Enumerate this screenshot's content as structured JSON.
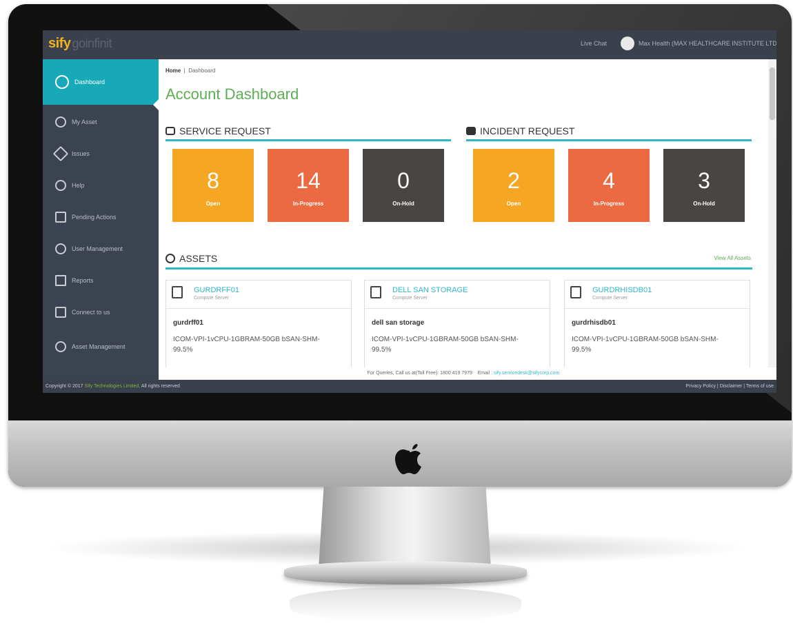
{
  "app": {
    "logo_brand": "sify",
    "logo_product": "goinfinit"
  },
  "topbar": {
    "live_chat": "Live Chat",
    "user_name": "Max Health (MAX HEALTHCARE INSTITUTE LTD)"
  },
  "sidebar": {
    "items": [
      {
        "label": "Dashboard",
        "icon": "dashboard-icon"
      },
      {
        "label": "My Asset",
        "icon": "asset-icon"
      },
      {
        "label": "Issues",
        "icon": "issues-icon"
      },
      {
        "label": "Help",
        "icon": "help-icon"
      },
      {
        "label": "Pending Actions",
        "icon": "pending-icon"
      },
      {
        "label": "User Management",
        "icon": "user-management-icon"
      },
      {
        "label": "Reports",
        "icon": "reports-icon"
      },
      {
        "label": "Connect to us",
        "icon": "chat-icon"
      },
      {
        "label": "Asset Management",
        "icon": "asset-management-icon"
      }
    ]
  },
  "breadcrumb": {
    "home": "Home",
    "current": "Dashboard"
  },
  "page_title": "Account Dashboard",
  "service_request": {
    "title": "SERVICE REQUEST",
    "tiles": [
      {
        "value": "8",
        "label": "Open"
      },
      {
        "value": "14",
        "label": "In-Progress"
      },
      {
        "value": "0",
        "label": "On-Hold"
      }
    ]
  },
  "incident_request": {
    "title": "INCIDENT REQUEST",
    "tiles": [
      {
        "value": "2",
        "label": "Open"
      },
      {
        "value": "4",
        "label": "In-Progress"
      },
      {
        "value": "3",
        "label": "On-Hold"
      }
    ]
  },
  "assets": {
    "title": "ASSETS",
    "view_all": "View All Assets",
    "cards": [
      {
        "title": "GURDRFF01",
        "subtitle": "Compute Server",
        "name": "gurdrff01",
        "desc": "ICOM-VPI-1vCPU-1GBRAM-50GB bSAN-SHM-99.5%"
      },
      {
        "title": "DELL SAN STORAGE",
        "subtitle": "Compute Server",
        "name": "dell san storage",
        "desc": "ICOM-VPI-1vCPU-1GBRAM-50GB bSAN-SHM-99.5%"
      },
      {
        "title": "GURDRHISDB01",
        "subtitle": "Compute Server",
        "name": "gurdrhisdb01",
        "desc": "ICOM-VPI-1vCPU-1GBRAM-50GB bSAN-SHM-99.5%"
      }
    ]
  },
  "contact": {
    "queries": "For Queries, Call us at(Toll Free): 1800 419 7979",
    "email_label": "Email :",
    "email": "sify.servicedesk@sifycorp.com"
  },
  "footer": {
    "copyright": "Copyright © 2017",
    "company": "Sify Technologies Limited,",
    "rights": "All rights reserved",
    "links": "Privacy Policy | Disclaimer | Terms of use"
  },
  "colors": {
    "accent": "#18a9b8",
    "open": "#f5a623",
    "in_progress": "#ec6a42",
    "on_hold": "#484543",
    "title_green": "#5cae55"
  }
}
